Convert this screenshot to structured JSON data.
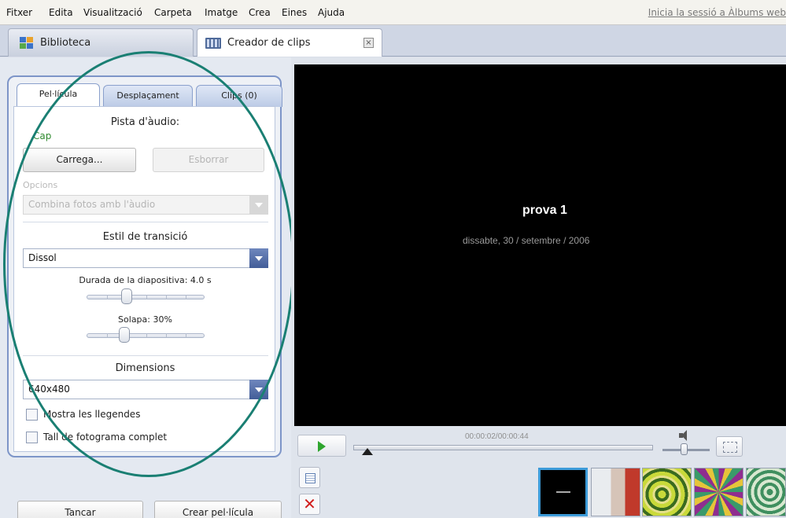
{
  "menu": {
    "items": [
      "Fitxer",
      "Edita",
      "Visualització",
      "Carpeta",
      "Imatge",
      "Crea",
      "Eines",
      "Ajuda"
    ],
    "signin_link": "Inicia la sessió a Àlbums web"
  },
  "tabs": {
    "biblioteca": "Biblioteca",
    "creador": "Creador de clips",
    "close_symbol": "×"
  },
  "panel": {
    "tabs": [
      "Pel·lícula",
      "Desplaçament",
      "Clips (0)"
    ],
    "audio_title": "Pista d'àudio:",
    "audio_value": "Cap",
    "load_button": "Carrega...",
    "delete_button": "Esborrar",
    "options_label": "Opcions",
    "options_select": "Combina fotos amb l'àudio",
    "transition_title": "Estil de transició",
    "transition_select": "Dissol",
    "slide_duration_label": "Durada de la diapositiva: 4.0 s",
    "slide_duration_value": 4.0,
    "overlap_label": "Solapa: 30%",
    "overlap_value": 0.3,
    "dimensions_title": "Dimensions",
    "dimensions_select": "640x480",
    "show_captions_label": "Mostra les llegendes",
    "show_captions_checked": false,
    "full_frame_crop_label": "Tall de fotograma complet",
    "full_frame_crop_checked": false
  },
  "footer": {
    "close_button": "Tancar",
    "create_button": "Crear pel·lícula"
  },
  "preview": {
    "title": "prova 1",
    "date": "dissabte, 30 / setembre / 2006",
    "time_readout": "00:00:02/00:00:44"
  },
  "colors": {
    "annotation": "#1a7f73",
    "play_green": "#2ea52e",
    "remove_red": "#d11d1d",
    "selected_thumb": "#3d9bd9"
  },
  "icons": {
    "play": "play-icon",
    "volume": "volume-icon",
    "fullscreen": "fullscreen-icon",
    "add_text": "add-text-slide-icon",
    "remove": "remove-icon"
  }
}
